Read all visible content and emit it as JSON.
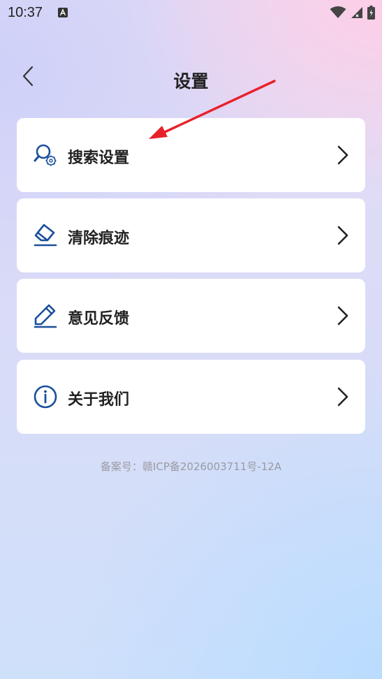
{
  "status_bar": {
    "time": "10:37",
    "notification_icon": "text-a-icon",
    "icons": [
      "wifi-icon",
      "signal-icon",
      "battery-icon"
    ]
  },
  "header": {
    "title": "设置",
    "back_icon": "chevron-left-icon"
  },
  "menu": {
    "items": [
      {
        "label": "搜索设置",
        "icon": "search-settings-icon"
      },
      {
        "label": "清除痕迹",
        "icon": "eraser-icon"
      },
      {
        "label": "意见反馈",
        "icon": "pencil-icon"
      },
      {
        "label": "关于我们",
        "icon": "info-icon"
      }
    ],
    "chevron_icon": "chevron-right-icon"
  },
  "footer": {
    "icp": "备案号：赣ICP备2026003711号-12A"
  },
  "colors": {
    "icon_blue": "#1a4f9c",
    "annotation_red": "#e8212b",
    "text_dark": "#222222",
    "text_muted": "#9a9aa3"
  }
}
